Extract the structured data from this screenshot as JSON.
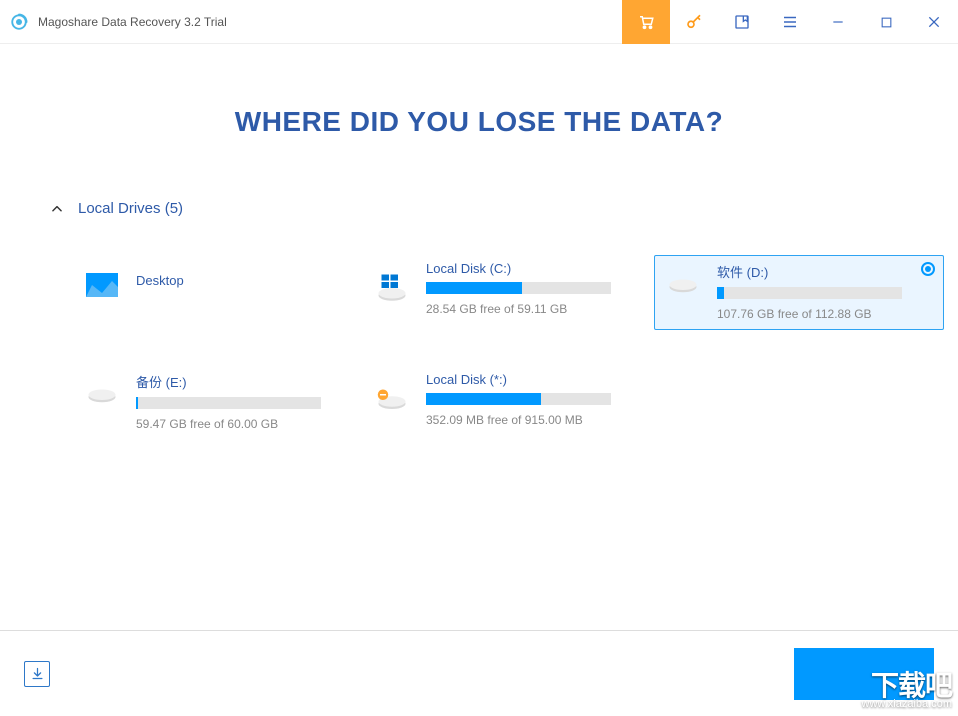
{
  "app": {
    "title": "Magoshare Data Recovery 3.2 Trial"
  },
  "titlebar": {
    "cart": "cart",
    "key": "key",
    "bookmark": "bookmark",
    "menu": "menu",
    "minimize": "minimize",
    "maximize": "maximize",
    "close": "close"
  },
  "page": {
    "heading": "WHERE DID YOU LOSE THE DATA?"
  },
  "section": {
    "title": "Local Drives (5)"
  },
  "drives": [
    {
      "name": "Desktop",
      "kind": "desktop",
      "status": "",
      "usage_pct": 0,
      "selected": false
    },
    {
      "name": "Local Disk (C:)",
      "kind": "windows",
      "status": "28.54 GB free of 59.11 GB",
      "usage_pct": 52,
      "selected": false
    },
    {
      "name": "软件 (D:)",
      "kind": "drive",
      "status": "107.76 GB free of 112.88 GB",
      "usage_pct": 4,
      "selected": true
    },
    {
      "name": "备份 (E:)",
      "kind": "drive",
      "status": "59.47 GB free of 60.00 GB",
      "usage_pct": 1,
      "selected": false
    },
    {
      "name": "Local Disk (*:)",
      "kind": "warn",
      "status": "352.09 MB free of 915.00 MB",
      "usage_pct": 62,
      "selected": false
    }
  ],
  "watermark": {
    "big": "下载吧",
    "small": "www.xiazaiba.com"
  }
}
